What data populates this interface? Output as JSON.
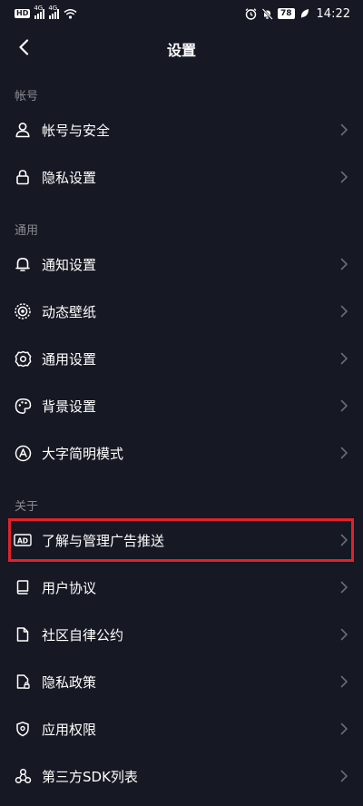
{
  "status_bar": {
    "hd": "HD",
    "net1": "4G",
    "net2": "4G",
    "battery": "78",
    "time": "14:22"
  },
  "header": {
    "title": "设置"
  },
  "sections": {
    "account": {
      "label": "帐号",
      "items": [
        {
          "label": "帐号与安全",
          "icon": "user-icon"
        },
        {
          "label": "隐私设置",
          "icon": "lock-icon"
        }
      ]
    },
    "general": {
      "label": "通用",
      "items": [
        {
          "label": "通知设置",
          "icon": "bell-icon"
        },
        {
          "label": "动态壁纸",
          "icon": "live-wallpaper-icon"
        },
        {
          "label": "通用设置",
          "icon": "gear-icon"
        },
        {
          "label": "背景设置",
          "icon": "palette-icon"
        },
        {
          "label": "大字简明模式",
          "icon": "font-size-icon"
        }
      ]
    },
    "about": {
      "label": "关于",
      "items": [
        {
          "label": "了解与管理广告推送",
          "icon": "ad-icon",
          "ad_text": "AD"
        },
        {
          "label": "用户协议",
          "icon": "book-icon"
        },
        {
          "label": "社区自律公约",
          "icon": "document-icon"
        },
        {
          "label": "隐私政策",
          "icon": "privacy-policy-icon"
        },
        {
          "label": "应用权限",
          "icon": "shield-icon"
        },
        {
          "label": "第三方SDK列表",
          "icon": "sdk-icon"
        }
      ]
    }
  },
  "colors": {
    "background": "#161823",
    "section_label": "#8a8b91",
    "chevron": "#6b6c73",
    "highlight": "#e0222d"
  }
}
